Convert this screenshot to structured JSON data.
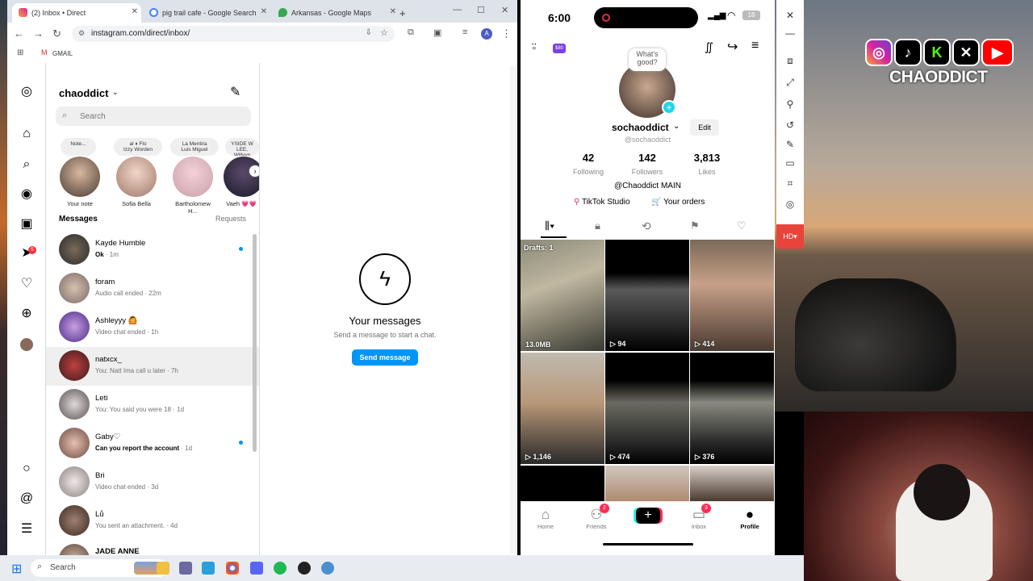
{
  "browser": {
    "tabs": [
      {
        "label": "(2) Inbox • Direct",
        "active": true
      },
      {
        "label": "pig trail cafe - Google Search",
        "active": false
      },
      {
        "label": "Arkansas - Google Maps",
        "active": false
      }
    ],
    "new_tab": "+",
    "url": "instagram.com/direct/inbox/",
    "bookmarks": [
      "GMAIL"
    ],
    "profile_initial": "A"
  },
  "instagram": {
    "username": "chaoddict",
    "search_placeholder": "Search",
    "notes": [
      {
        "text": "Note..."
      },
      {
        "text": "al ⏸ Flo\nIzzy Worden"
      },
      {
        "text": "La Mentira\nLuis Miguel"
      },
      {
        "text": "YSIDE W\nLEE, Willyyn"
      }
    ],
    "stories": [
      {
        "label": "Your note"
      },
      {
        "label": "Sofia Bella"
      },
      {
        "label": "Bartholomew H..."
      },
      {
        "label": "Vaeh 💗💗"
      }
    ],
    "messages_title": "Messages",
    "requests_label": "Requests",
    "rail_badge": "5",
    "threads": [
      {
        "name": "Kayde Humble",
        "preview": "Ok",
        "time": "· 1m",
        "unread": true
      },
      {
        "name": "foram",
        "preview": "Audio call ended",
        "time": "· 22m",
        "unread": false
      },
      {
        "name": "Ashleyyy 🙆",
        "preview": "Video chat ended",
        "time": "· 1h",
        "unread": false
      },
      {
        "name": "natxcx_",
        "preview": "You: Natt Ima call u later",
        "time": "· 7h",
        "unread": false
      },
      {
        "name": "Leti",
        "preview": "You: You said you were 18",
        "time": "· 1d",
        "unread": false
      },
      {
        "name": "Gaby♡",
        "preview": "Can you report the account",
        "time": "· 1d",
        "unread": true
      },
      {
        "name": "Bri",
        "preview": "Video chat ended",
        "time": "· 3d",
        "unread": false
      },
      {
        "name": "Lů",
        "preview": "You sent an attachment.",
        "time": "· 4d",
        "unread": false
      },
      {
        "name": "JADE ANNE",
        "preview": "",
        "time": "",
        "unread": false
      }
    ],
    "empty_title": "Your messages",
    "empty_sub": "Send a message to start a chat.",
    "send_button": "Send message"
  },
  "tiktok": {
    "time": "6:00",
    "battery": "18",
    "bubble": "What's good?",
    "username": "sochaoddict",
    "handle": "@sochaoddict",
    "edit": "Edit",
    "stats": [
      {
        "value": "42",
        "label": "Following"
      },
      {
        "value": "142",
        "label": "Followers"
      },
      {
        "value": "3,813",
        "label": "Likes"
      }
    ],
    "bio": "@Chaoddict MAIN",
    "studio": "TikTok Studio",
    "orders": "Your orders",
    "coin_badge": "$80",
    "drafts": "Drafts: 1",
    "videos": [
      "13.0MB",
      "▷ 94",
      "▷ 414",
      "▷ 1,146",
      "▷ 474",
      "▷ 376"
    ],
    "nav": [
      {
        "label": "Home",
        "badge": ""
      },
      {
        "label": "Friends",
        "badge": "2"
      },
      {
        "label": "",
        "badge": ""
      },
      {
        "label": "Inbox",
        "badge": "3"
      },
      {
        "label": "Profile",
        "badge": ""
      }
    ]
  },
  "overlay": {
    "brand": "CHAODDICT",
    "socials": [
      "instagram-icon",
      "tiktok-icon",
      "kick-icon",
      "x-icon",
      "youtube-icon"
    ]
  },
  "side_strip": {
    "hd": "HD"
  },
  "taskbar": {
    "search": "Search"
  }
}
